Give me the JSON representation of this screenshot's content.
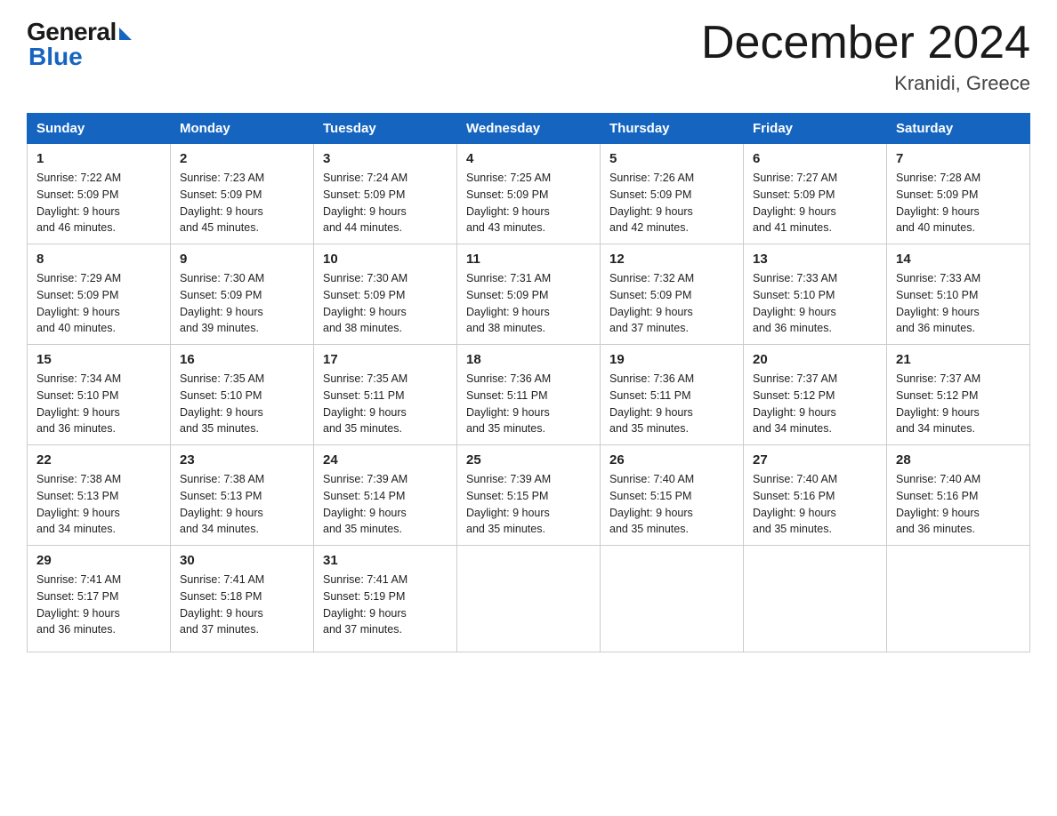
{
  "logo": {
    "general": "General",
    "blue": "Blue"
  },
  "title": "December 2024",
  "location": "Kranidi, Greece",
  "headers": [
    "Sunday",
    "Monday",
    "Tuesday",
    "Wednesday",
    "Thursday",
    "Friday",
    "Saturday"
  ],
  "weeks": [
    [
      {
        "day": "1",
        "sunrise": "7:22 AM",
        "sunset": "5:09 PM",
        "daylight": "9 hours and 46 minutes."
      },
      {
        "day": "2",
        "sunrise": "7:23 AM",
        "sunset": "5:09 PM",
        "daylight": "9 hours and 45 minutes."
      },
      {
        "day": "3",
        "sunrise": "7:24 AM",
        "sunset": "5:09 PM",
        "daylight": "9 hours and 44 minutes."
      },
      {
        "day": "4",
        "sunrise": "7:25 AM",
        "sunset": "5:09 PM",
        "daylight": "9 hours and 43 minutes."
      },
      {
        "day": "5",
        "sunrise": "7:26 AM",
        "sunset": "5:09 PM",
        "daylight": "9 hours and 42 minutes."
      },
      {
        "day": "6",
        "sunrise": "7:27 AM",
        "sunset": "5:09 PM",
        "daylight": "9 hours and 41 minutes."
      },
      {
        "day": "7",
        "sunrise": "7:28 AM",
        "sunset": "5:09 PM",
        "daylight": "9 hours and 40 minutes."
      }
    ],
    [
      {
        "day": "8",
        "sunrise": "7:29 AM",
        "sunset": "5:09 PM",
        "daylight": "9 hours and 40 minutes."
      },
      {
        "day": "9",
        "sunrise": "7:30 AM",
        "sunset": "5:09 PM",
        "daylight": "9 hours and 39 minutes."
      },
      {
        "day": "10",
        "sunrise": "7:30 AM",
        "sunset": "5:09 PM",
        "daylight": "9 hours and 38 minutes."
      },
      {
        "day": "11",
        "sunrise": "7:31 AM",
        "sunset": "5:09 PM",
        "daylight": "9 hours and 38 minutes."
      },
      {
        "day": "12",
        "sunrise": "7:32 AM",
        "sunset": "5:09 PM",
        "daylight": "9 hours and 37 minutes."
      },
      {
        "day": "13",
        "sunrise": "7:33 AM",
        "sunset": "5:10 PM",
        "daylight": "9 hours and 36 minutes."
      },
      {
        "day": "14",
        "sunrise": "7:33 AM",
        "sunset": "5:10 PM",
        "daylight": "9 hours and 36 minutes."
      }
    ],
    [
      {
        "day": "15",
        "sunrise": "7:34 AM",
        "sunset": "5:10 PM",
        "daylight": "9 hours and 36 minutes."
      },
      {
        "day": "16",
        "sunrise": "7:35 AM",
        "sunset": "5:10 PM",
        "daylight": "9 hours and 35 minutes."
      },
      {
        "day": "17",
        "sunrise": "7:35 AM",
        "sunset": "5:11 PM",
        "daylight": "9 hours and 35 minutes."
      },
      {
        "day": "18",
        "sunrise": "7:36 AM",
        "sunset": "5:11 PM",
        "daylight": "9 hours and 35 minutes."
      },
      {
        "day": "19",
        "sunrise": "7:36 AM",
        "sunset": "5:11 PM",
        "daylight": "9 hours and 35 minutes."
      },
      {
        "day": "20",
        "sunrise": "7:37 AM",
        "sunset": "5:12 PM",
        "daylight": "9 hours and 34 minutes."
      },
      {
        "day": "21",
        "sunrise": "7:37 AM",
        "sunset": "5:12 PM",
        "daylight": "9 hours and 34 minutes."
      }
    ],
    [
      {
        "day": "22",
        "sunrise": "7:38 AM",
        "sunset": "5:13 PM",
        "daylight": "9 hours and 34 minutes."
      },
      {
        "day": "23",
        "sunrise": "7:38 AM",
        "sunset": "5:13 PM",
        "daylight": "9 hours and 34 minutes."
      },
      {
        "day": "24",
        "sunrise": "7:39 AM",
        "sunset": "5:14 PM",
        "daylight": "9 hours and 35 minutes."
      },
      {
        "day": "25",
        "sunrise": "7:39 AM",
        "sunset": "5:15 PM",
        "daylight": "9 hours and 35 minutes."
      },
      {
        "day": "26",
        "sunrise": "7:40 AM",
        "sunset": "5:15 PM",
        "daylight": "9 hours and 35 minutes."
      },
      {
        "day": "27",
        "sunrise": "7:40 AM",
        "sunset": "5:16 PM",
        "daylight": "9 hours and 35 minutes."
      },
      {
        "day": "28",
        "sunrise": "7:40 AM",
        "sunset": "5:16 PM",
        "daylight": "9 hours and 36 minutes."
      }
    ],
    [
      {
        "day": "29",
        "sunrise": "7:41 AM",
        "sunset": "5:17 PM",
        "daylight": "9 hours and 36 minutes."
      },
      {
        "day": "30",
        "sunrise": "7:41 AM",
        "sunset": "5:18 PM",
        "daylight": "9 hours and 37 minutes."
      },
      {
        "day": "31",
        "sunrise": "7:41 AM",
        "sunset": "5:19 PM",
        "daylight": "9 hours and 37 minutes."
      },
      null,
      null,
      null,
      null
    ]
  ],
  "labels": {
    "sunrise": "Sunrise:",
    "sunset": "Sunset:",
    "daylight": "Daylight:"
  }
}
